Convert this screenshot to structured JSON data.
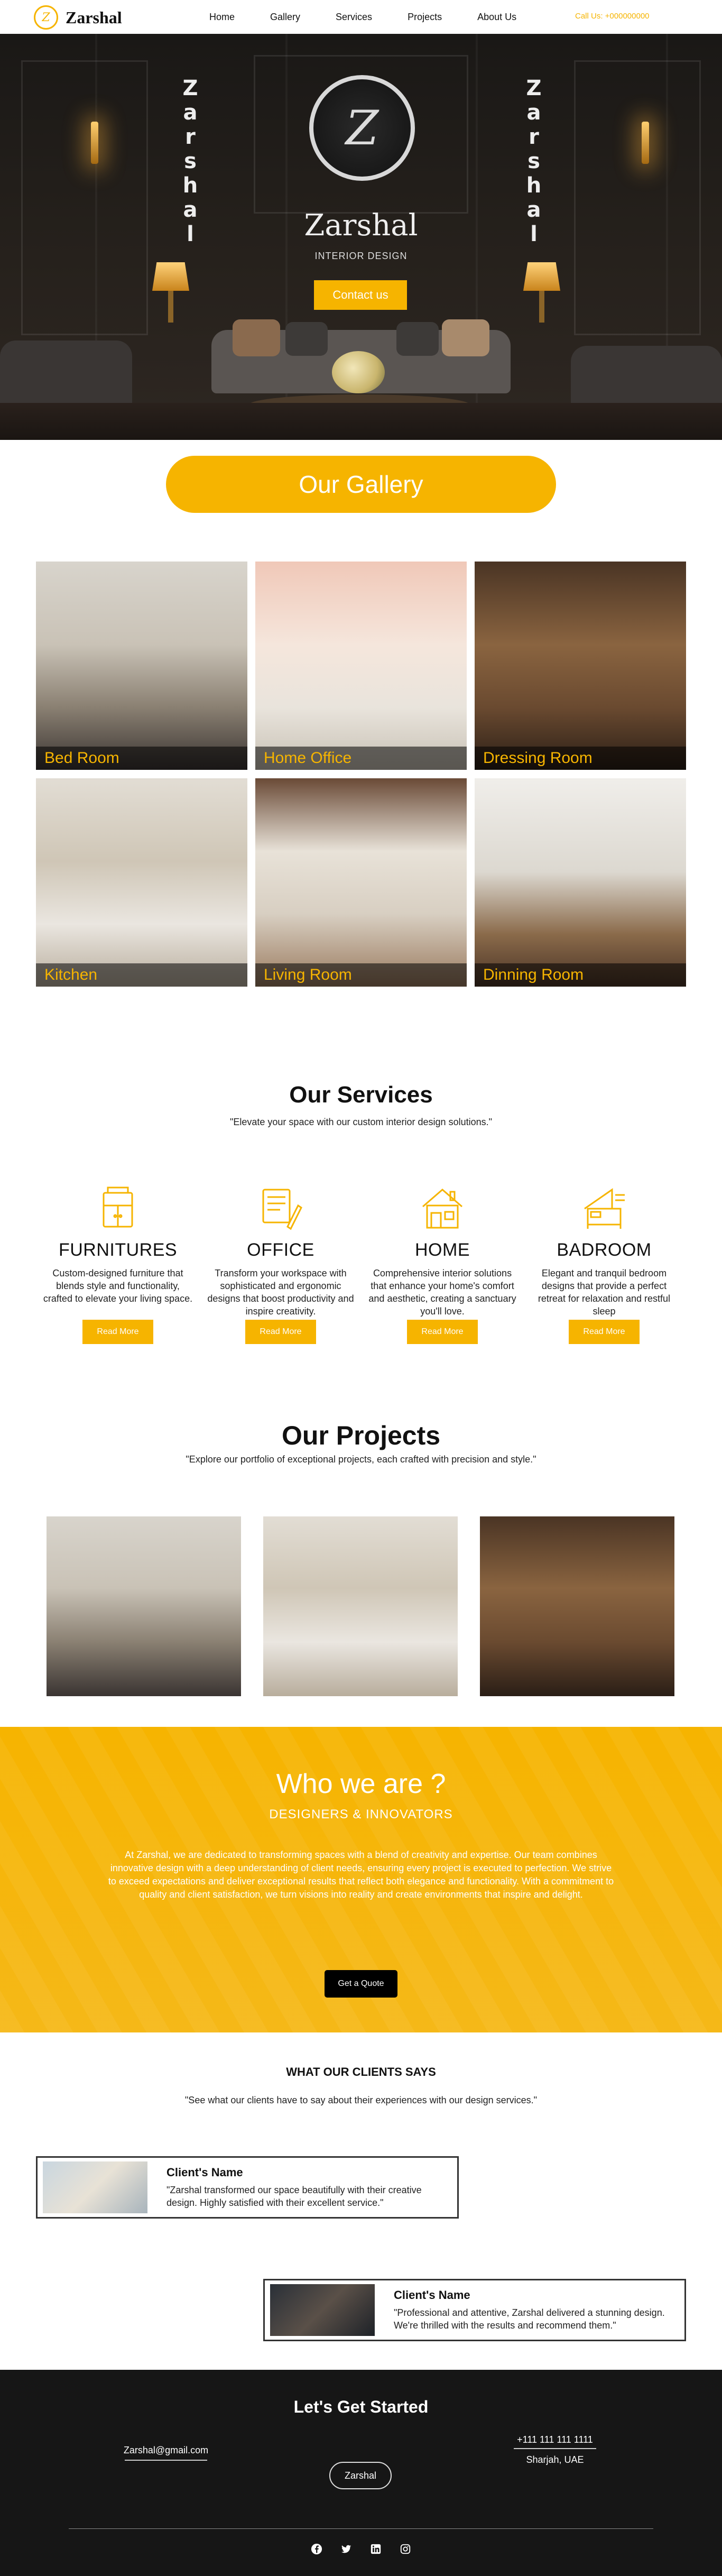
{
  "nav": {
    "brand": "Zarshal",
    "logo_icon": "zarshal-monogram",
    "links": [
      "Home",
      "Gallery",
      "Services",
      "Projects",
      "About Us"
    ],
    "phone": "Call Us: +000000000"
  },
  "hero": {
    "vertical_text": [
      "Z",
      "a",
      "r",
      "s",
      "h",
      "a",
      "l"
    ],
    "brand": "Zarshal",
    "subtitle": "INTERIOR DESIGN",
    "cta": "Contact us"
  },
  "gallery": {
    "title": "Our Gallery",
    "items": [
      "Bed Room",
      "Home Office",
      "Dressing Room",
      "Kitchen",
      "Living Room",
      "Dinning Room"
    ]
  },
  "services": {
    "title": "Our Services",
    "subtitle": "\"Elevate your space with our custom interior design solutions.\"",
    "items": [
      {
        "icon": "cabinet-icon",
        "title": "FURNITURES",
        "desc": "Custom-designed furniture that blends style and functionality, crafted to elevate your living space.",
        "button": "Read More"
      },
      {
        "icon": "workspace-icon",
        "title": "OFFICE",
        "desc": "Transform your workspace with sophisticated and ergonomic designs that boost productivity and inspire creativity.",
        "button": "Read More"
      },
      {
        "icon": "house-icon",
        "title": "HOME",
        "desc": "Comprehensive interior solutions that enhance your home's comfort and aesthetic, creating a sanctuary you'll love.",
        "button": "Read More"
      },
      {
        "icon": "bedroom-icon",
        "title": "BADROOM",
        "desc": "Elegant and tranquil bedroom designs that provide a perfect retreat for relaxation and restful sleep",
        "button": "Read More"
      }
    ]
  },
  "projects": {
    "title": "Our Projects",
    "subtitle": "\"Explore our portfolio of exceptional projects, each crafted with precision and style.\""
  },
  "about": {
    "title": "Who we are ?",
    "subtitle": "DESIGNERS & INNOVATORS",
    "body": "At Zarshal, we are dedicated to transforming spaces with a blend of creativity and expertise. Our team combines innovative design with a deep understanding of client needs, ensuring every project is executed to perfection. We strive to exceed expectations and deliver exceptional results that reflect both elegance and functionality. With a commitment to quality and client satisfaction, we turn visions into reality and create environments that inspire and delight.",
    "button": "Get a Quote"
  },
  "testimonials": {
    "title": "WHAT OUR CLIENTS SAYS",
    "subtitle": "\"See what our clients have to say about their experiences with our design services.\"",
    "items": [
      {
        "name": "Client's Name",
        "text": "\"Zarshal transformed our space beautifully with their creative design. Highly satisfied with their excellent service.\""
      },
      {
        "name": "Client's Name",
        "text": "\"Professional and attentive, Zarshal delivered a stunning design. We're thrilled with the results and recommend them.\""
      }
    ]
  },
  "footer": {
    "title": "Let's Get Started",
    "email": "Zarshal@gmail.com",
    "brand_button": "Zarshal",
    "phone": "+111 111 111 1111",
    "location": "Sharjah, UAE",
    "socials": [
      "facebook-icon",
      "twitter-icon",
      "linkedin-icon",
      "instagram-icon"
    ]
  },
  "colors": {
    "accent": "#f6b400",
    "dark": "#161616"
  }
}
